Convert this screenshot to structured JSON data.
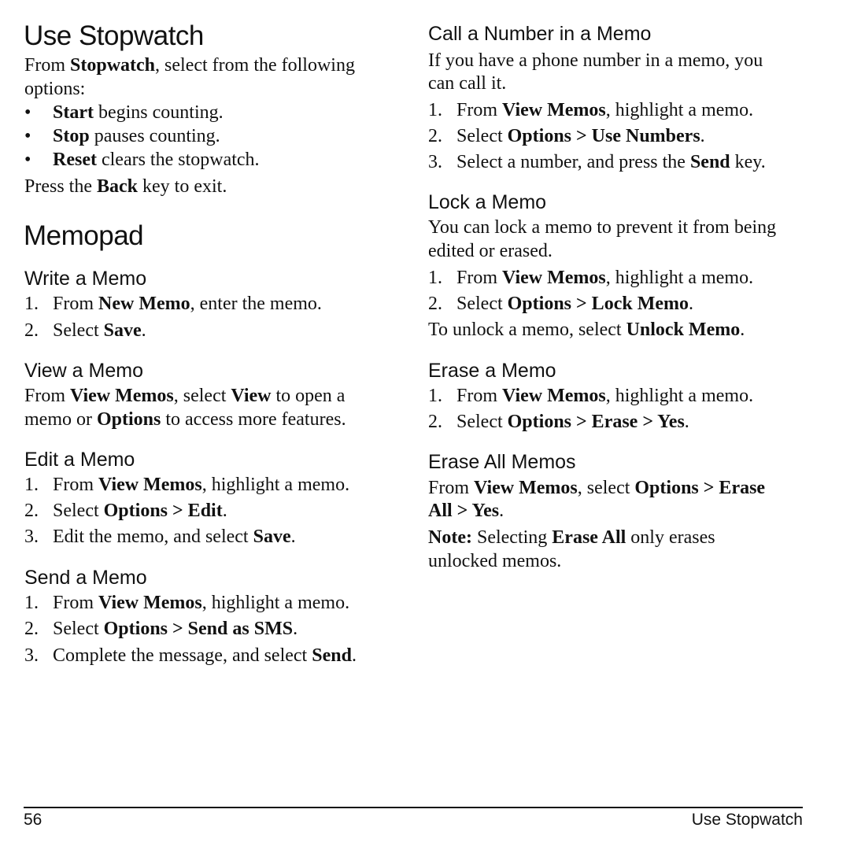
{
  "left": {
    "stopwatch": {
      "title": "Use Stopwatch",
      "intro": [
        "From ",
        "Stopwatch",
        ", select from the following options:"
      ],
      "bullets": [
        {
          "bold": "Start",
          "text": " begins counting."
        },
        {
          "bold": "Stop",
          "text": " pauses counting."
        },
        {
          "bold": "Reset",
          "text": " clears the stopwatch."
        }
      ],
      "bullet_glyph": "•",
      "outro": [
        "Press the ",
        "Back",
        " key to exit."
      ]
    },
    "memopad_title": "Memopad",
    "write": {
      "title": "Write a Memo",
      "steps": [
        {
          "n": "1.",
          "a": "From ",
          "b": "New Memo",
          "c": ", enter the memo."
        },
        {
          "n": "2.",
          "a": "Select ",
          "b": "Save",
          "c": "."
        }
      ]
    },
    "view": {
      "title": "View a Memo",
      "line1": [
        "From ",
        "View Memos",
        ", select ",
        "View",
        " to open a"
      ],
      "line2": [
        "memo or ",
        "Options",
        " to access more features."
      ]
    },
    "edit": {
      "title": "Edit a Memo",
      "steps": [
        {
          "n": "1.",
          "a": "From ",
          "b": "View Memos",
          "c": ", highlight a memo."
        },
        {
          "n": "2.",
          "a": "Select ",
          "b": "Options > Edit",
          "c": "."
        },
        {
          "n": "3.",
          "a": "Edit the memo, and select ",
          "b": "Save",
          "c": "."
        }
      ]
    },
    "send": {
      "title": "Send a Memo",
      "steps": [
        {
          "n": "1.",
          "a": "From ",
          "b": "View Memos",
          "c": ", highlight a memo."
        },
        {
          "n": "2.",
          "a": "Select ",
          "b": "Options > Send as SMS",
          "c": "."
        },
        {
          "n": "3.",
          "a": "Complete the message, and select ",
          "b": "Send",
          "c": "."
        }
      ]
    }
  },
  "right": {
    "call": {
      "title": "Call a Number in a Memo",
      "intro1": "If you have a phone number in a memo, you",
      "intro2": "can call it.",
      "steps": [
        {
          "n": "1.",
          "a": "From ",
          "b": "View Memos",
          "c": ", highlight a memo."
        },
        {
          "n": "2.",
          "a": "Select ",
          "b": "Options > Use Numbers",
          "c": "."
        },
        {
          "n": "3.",
          "a": "Select a number, and press the ",
          "b": "Send",
          "c": " key."
        }
      ]
    },
    "lock": {
      "title": "Lock a Memo",
      "intro1": "You can lock a memo to prevent it from being",
      "intro2": "edited or erased.",
      "steps": [
        {
          "n": "1.",
          "a": "From ",
          "b": "View Memos",
          "c": ", highlight a memo."
        },
        {
          "n": "2.",
          "a": "Select ",
          "b": "Options > Lock Memo",
          "c": "."
        }
      ],
      "unlock": [
        "To unlock a memo, select ",
        "Unlock Memo",
        "."
      ]
    },
    "erase": {
      "title": "Erase a Memo",
      "steps": [
        {
          "n": "1.",
          "a": "From ",
          "b": "View Memos",
          "c": ", highlight a memo."
        },
        {
          "n": "2.",
          "a": "Select ",
          "b": "Options > Erase > Yes",
          "c": "."
        }
      ]
    },
    "erase_all": {
      "title": "Erase All Memos",
      "line1": [
        "From ",
        "View Memos",
        ", select ",
        "Options > Erase"
      ],
      "line2": [
        "All > Yes",
        "."
      ],
      "note1": [
        "Note:",
        " Selecting ",
        "Erase All",
        " only erases"
      ],
      "note2": "unlocked memos."
    }
  },
  "footer": {
    "page_number": "56",
    "section": "Use Stopwatch"
  }
}
